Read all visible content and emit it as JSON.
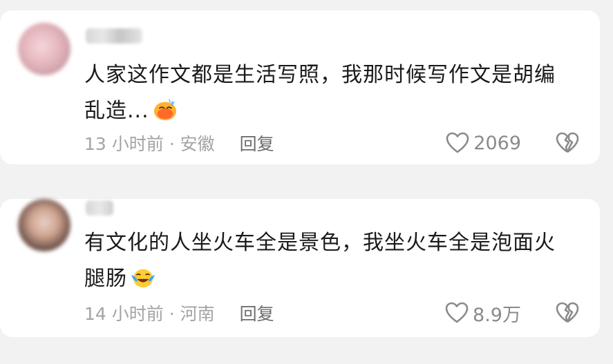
{
  "comments": [
    {
      "text_line1": "人家这作文都是生活写照，我那时候写作文是胡编",
      "text_line2": "乱造...",
      "emoji": "sweat-laugh-emoji",
      "time_location": "13 小时前 · 安徽",
      "reply_label": "回复",
      "like_count": "2069"
    },
    {
      "text_line1": "有文化的人坐火车全是景色，我坐火车全是泡面火",
      "text_line2": "腿肠",
      "emoji": "tears-of-joy-emoji",
      "time_location": "14 小时前 · 河南",
      "reply_label": "回复",
      "like_count": "8.9万"
    }
  ],
  "icons": {
    "like": "heart-outline-icon",
    "dislike": "broken-heart-icon"
  },
  "colors": {
    "text": "#1a1a1a",
    "meta": "#a3a3a3",
    "reply": "#6d6d6d",
    "icon": "#8a8a8a"
  }
}
